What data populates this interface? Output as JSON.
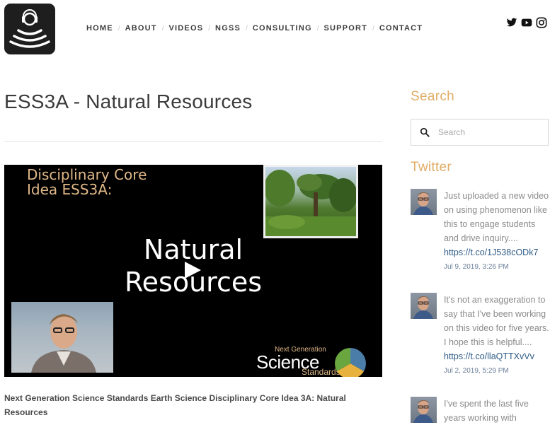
{
  "nav": {
    "items": [
      "HOME",
      "ABOUT",
      "VIDEOS",
      "NGSS",
      "CONSULTING",
      "SUPPORT",
      "CONTACT"
    ],
    "separator": "/"
  },
  "social": [
    "twitter-icon",
    "youtube-icon",
    "instagram-icon"
  ],
  "page": {
    "title": "ESS3A - Natural Resources",
    "caption": "Next Generation Science Standards Earth Science Disciplinary Core Idea 3A:  Natural Resources"
  },
  "video": {
    "overlay_line1": "Disciplinary Core",
    "overlay_line2": "Idea ESS3A:",
    "big_line1": "Natural",
    "big_line2": "Resources",
    "ngss_small": "Next Generation",
    "ngss_science": "Science",
    "ngss_standards": "Standards"
  },
  "sidebar": {
    "search_heading": "Search",
    "search_placeholder": "Search",
    "twitter_heading": "Twitter",
    "tweets": [
      {
        "text": "Just uploaded a new video on using phenomenon like this to engage students and drive inquiry....",
        "link": "https://t.co/1J538cODk7",
        "date": "Jul 9, 2019, 3:26 PM"
      },
      {
        "text": "It's not an exaggeration to say that I've been working on this video for five years. I hope this is helpful....",
        "link": "https://t.co/llaQTTXvVv",
        "date": "Jul 2, 2019, 5:29 PM"
      },
      {
        "text": "I've spent the last five years working with",
        "link": "",
        "date": ""
      }
    ]
  },
  "colors": {
    "accent": "#e0ad66",
    "link": "#2f5b86",
    "nav_text": "#3d3d3d",
    "logo_bg": "#1e1e1e"
  }
}
